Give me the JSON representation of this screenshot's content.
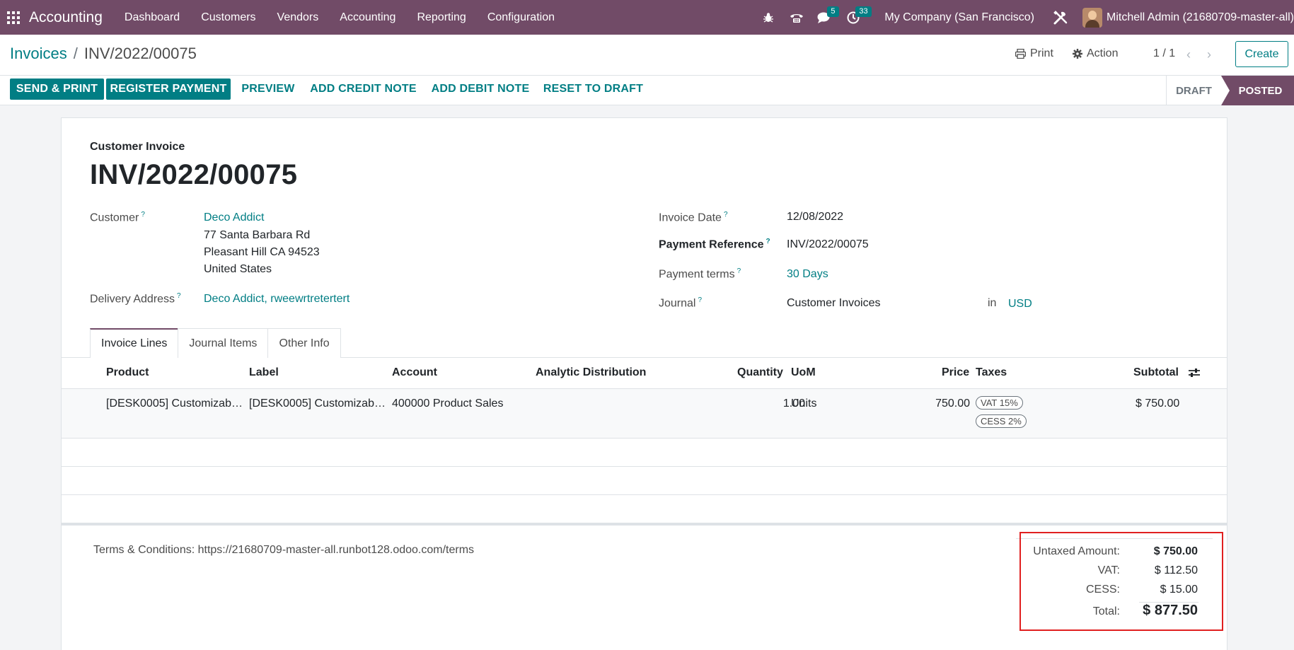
{
  "navbar": {
    "brand": "Accounting",
    "menu": [
      "Dashboard",
      "Customers",
      "Vendors",
      "Accounting",
      "Reporting",
      "Configuration"
    ],
    "messages_count": "5",
    "activities_count": "33",
    "company": "My Company (San Francisco)",
    "user": "Mitchell Admin (21680709-master-all)"
  },
  "breadcrumb": {
    "parent": "Invoices",
    "separator": "/",
    "current": "INV/2022/00075"
  },
  "control": {
    "print": "Print",
    "action": "Action",
    "pager": "1 / 1",
    "create": "Create"
  },
  "statusbar": {
    "buttons": [
      "SEND & PRINT",
      "REGISTER PAYMENT",
      "PREVIEW",
      "ADD CREDIT NOTE",
      "ADD DEBIT NOTE",
      "RESET TO DRAFT"
    ],
    "stages": [
      "DRAFT",
      "POSTED"
    ],
    "active_stage": "POSTED"
  },
  "form": {
    "subtitle": "Customer Invoice",
    "title": "INV/2022/00075",
    "customer_label": "Customer",
    "customer_name": "Deco Addict",
    "customer_address": [
      "77 Santa Barbara Rd",
      "Pleasant Hill CA 94523",
      "United States"
    ],
    "delivery_label": "Delivery Address",
    "delivery_value": "Deco Addict, rweewrtretertert",
    "invoice_date_label": "Invoice Date",
    "invoice_date": "12/08/2022",
    "payment_ref_label": "Payment Reference",
    "payment_ref": "INV/2022/00075",
    "payment_terms_label": "Payment terms",
    "payment_terms": "30 Days",
    "journal_label": "Journal",
    "journal": "Customer Invoices",
    "journal_in": "in",
    "currency": "USD",
    "help_mark": "?"
  },
  "tabs": [
    "Invoice Lines",
    "Journal Items",
    "Other Info"
  ],
  "lines": {
    "headers": {
      "product": "Product",
      "label": "Label",
      "account": "Account",
      "analytic": "Analytic Distribution",
      "quantity": "Quantity",
      "uom": "UoM",
      "price": "Price",
      "taxes": "Taxes",
      "subtotal": "Subtotal"
    },
    "rows": [
      {
        "product": "[DESK0005] Customizab…",
        "label": "[DESK0005] Customizab…",
        "account": "400000 Product Sales",
        "quantity": "1.00",
        "uom": "Units",
        "price": "750.00",
        "taxes": [
          "VAT 15%",
          "CESS 2%"
        ],
        "subtotal": "$ 750.00"
      }
    ]
  },
  "terms": "Terms & Conditions: https://21680709-master-all.runbot128.odoo.com/terms",
  "totals": {
    "untaxed_label": "Untaxed Amount:",
    "untaxed": "$ 750.00",
    "vat_label": "VAT:",
    "vat": "$ 112.50",
    "cess_label": "CESS:",
    "cess": "$ 15.00",
    "total_label": "Total:",
    "total": "$ 877.50"
  },
  "colors": {
    "brand": "#714b67",
    "accent": "#017e84",
    "highlight_box": "#e02020"
  }
}
